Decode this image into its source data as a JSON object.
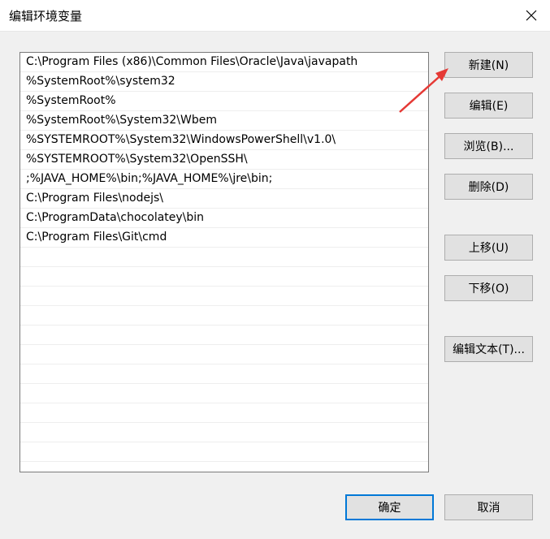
{
  "window": {
    "title": "编辑环境变量",
    "close_icon": "close-icon"
  },
  "list": {
    "rows": [
      "C:\\Program Files (x86)\\Common Files\\Oracle\\Java\\javapath",
      "%SystemRoot%\\system32",
      "%SystemRoot%",
      "%SystemRoot%\\System32\\Wbem",
      "%SYSTEMROOT%\\System32\\WindowsPowerShell\\v1.0\\",
      "%SYSTEMROOT%\\System32\\OpenSSH\\",
      ";%JAVA_HOME%\\bin;%JAVA_HOME%\\jre\\bin;",
      "C:\\Program Files\\nodejs\\",
      "C:\\ProgramData\\chocolatey\\bin",
      "C:\\Program Files\\Git\\cmd",
      "",
      "",
      "",
      "",
      "",
      "",
      "",
      "",
      "",
      "",
      "",
      ""
    ]
  },
  "buttons": {
    "new": "新建(N)",
    "edit": "编辑(E)",
    "browse": "浏览(B)...",
    "delete": "删除(D)",
    "move_up": "上移(U)",
    "move_down": "下移(O)",
    "edit_text": "编辑文本(T)...",
    "ok": "确定",
    "cancel": "取消"
  },
  "colors": {
    "annotation_arrow": "#e53935",
    "default_button_border": "#0078d7"
  }
}
